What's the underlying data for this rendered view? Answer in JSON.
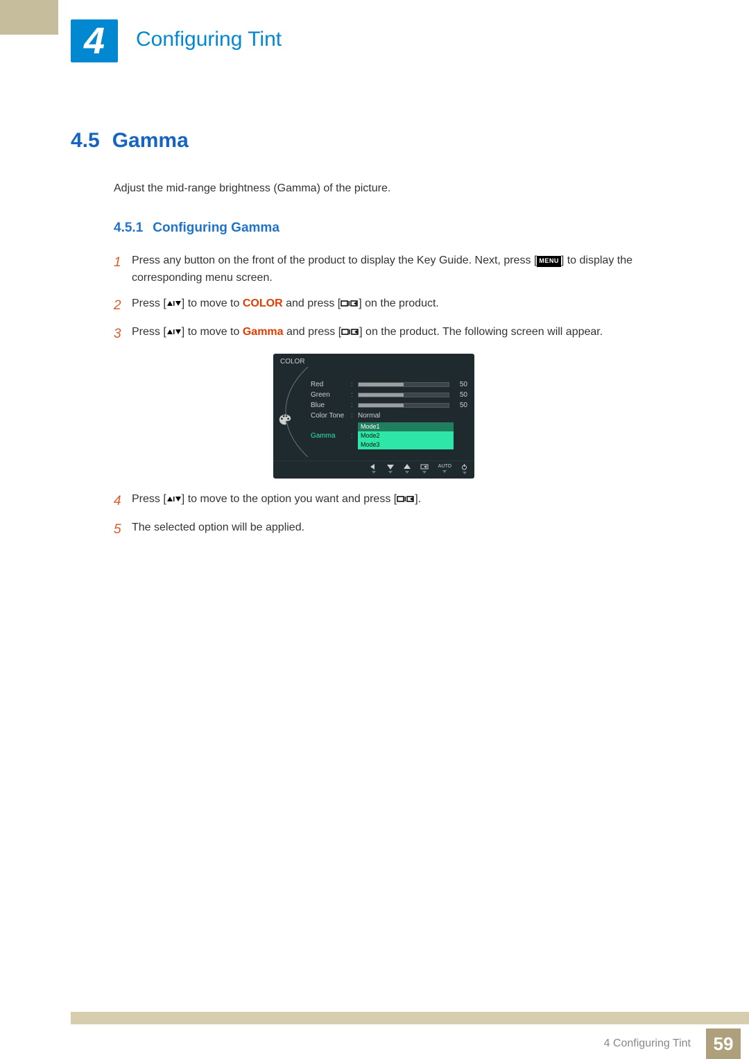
{
  "header": {
    "chapter_number": "4",
    "chapter_title": "Configuring Tint"
  },
  "section": {
    "number": "4.5",
    "title": "Gamma",
    "intro": "Adjust the mid-range brightness (Gamma) of the picture."
  },
  "subsection": {
    "number": "4.5.1",
    "title": "Configuring Gamma"
  },
  "steps": {
    "s1": {
      "num": "1",
      "text_a": "Press any button on the front of the product to display the Key Guide. Next, press [",
      "menu": "MENU",
      "text_b": "] to display the corresponding menu screen."
    },
    "s2": {
      "num": "2",
      "text_a": "Press [",
      "text_b": "] to move to ",
      "kw": "COLOR",
      "text_c": " and press [",
      "text_d": "] on the product."
    },
    "s3": {
      "num": "3",
      "text_a": "Press [",
      "text_b": "] to move to ",
      "kw": "Gamma",
      "text_c": " and press [",
      "text_d": "] on the product. The following screen will appear."
    },
    "s4": {
      "num": "4",
      "text_a": "Press [",
      "text_b": "] to move to the option you want and press [",
      "text_c": "]."
    },
    "s5": {
      "num": "5",
      "text": "The selected option will be applied."
    }
  },
  "osd": {
    "title": "COLOR",
    "rows": {
      "red": {
        "label": "Red",
        "value": "50",
        "pct": 50
      },
      "green": {
        "label": "Green",
        "value": "50",
        "pct": 50
      },
      "blue": {
        "label": "Blue",
        "value": "50",
        "pct": 50
      },
      "color_tone": {
        "label": "Color Tone",
        "value": "Normal"
      },
      "gamma": {
        "label": "Gamma"
      }
    },
    "dropdown": {
      "opt1": "Mode1",
      "opt2": "Mode2",
      "opt3": "Mode3"
    },
    "auto_label": "AUTO"
  },
  "footer": {
    "chapter": "4 Configuring Tint",
    "page": "59"
  }
}
